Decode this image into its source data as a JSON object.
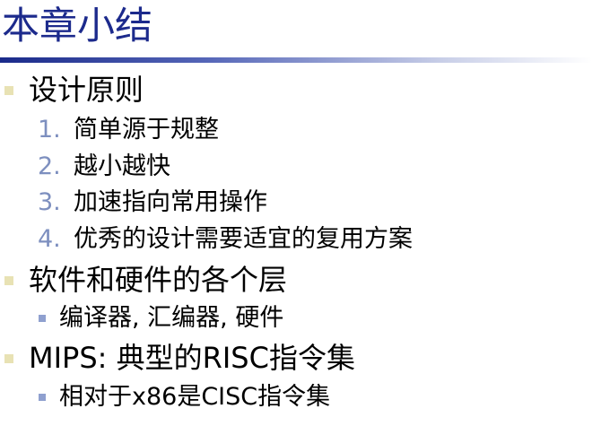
{
  "title": "本章小结",
  "sections": [
    {
      "label": "设计原则",
      "items": [
        {
          "num": "1.",
          "text": "简单源于规整"
        },
        {
          "num": "2.",
          "text": "越小越快"
        },
        {
          "num": "3.",
          "text": "加速指向常用操作"
        },
        {
          "num": "4.",
          "text": "优秀的设计需要适宜的复用方案"
        }
      ]
    },
    {
      "label": "软件和硬件的各个层",
      "sub": [
        "编译器, 汇编器, 硬件"
      ]
    },
    {
      "label": "MIPS: 典型的RISC指令集",
      "sub": [
        "相对于x86是CISC指令集"
      ]
    }
  ],
  "colors": {
    "title": "#1c2a8c",
    "bullet_level1": "#e8e2b4",
    "bullet_level2": "#8fa0cf",
    "number": "#7d8fbf"
  }
}
